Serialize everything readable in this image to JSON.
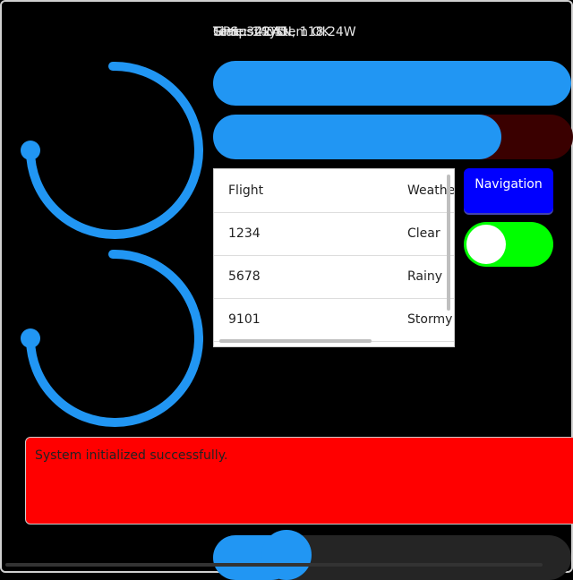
{
  "status_overlay": [
    "GPS: 34.05N, 118.24W",
    "Time: 14:45",
    "Status: System OK",
    "Temp: 22°C"
  ],
  "table": {
    "headers": [
      "Flight",
      "Weather"
    ],
    "rows": [
      [
        "1234",
        "Clear"
      ],
      [
        "5678",
        "Rainy"
      ],
      [
        "9101",
        "Stormy"
      ]
    ]
  },
  "nav_button": {
    "label": "Navigation"
  },
  "toggle": {
    "on": true
  },
  "message": {
    "text": "System initialized successfully."
  },
  "progress_bars": [
    {
      "value": 1.0
    },
    {
      "value": 0.8
    }
  ],
  "gauges": [
    {
      "value": 0.75
    },
    {
      "value": 0.75
    }
  ],
  "slider": {
    "value": 0.2
  },
  "colors": {
    "accent": "#2196f3",
    "nav": "#0000ff",
    "toggle": "#00ff00",
    "message_bg": "#ff0000"
  }
}
